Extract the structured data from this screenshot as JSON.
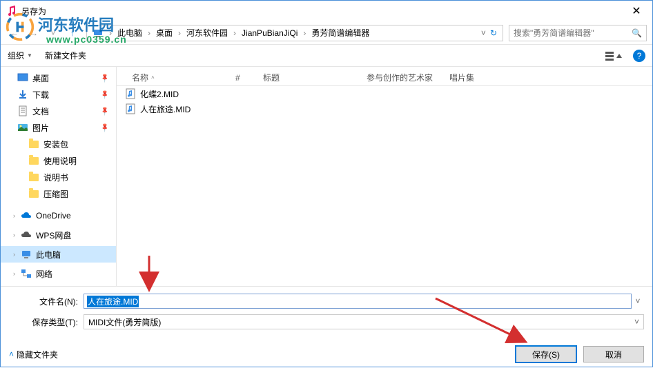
{
  "window": {
    "title": "另存为"
  },
  "nav": {
    "crumbs": [
      "此电脑",
      "桌面",
      "河东软件园",
      "JianPuBianJiQi",
      "勇芳简谱编辑器"
    ],
    "search_placeholder": "搜索\"勇芳简谱编辑器\""
  },
  "toolbar": {
    "organize": "组织",
    "new_folder": "新建文件夹"
  },
  "sidebar": {
    "desktop": "桌面",
    "downloads": "下载",
    "documents": "文档",
    "pictures": "图片",
    "folder1": "安装包",
    "folder2": "使用说明",
    "folder3": "说明书",
    "folder4": "压缩图",
    "onedrive": "OneDrive",
    "wps": "WPS网盘",
    "thispc": "此电脑",
    "network": "网络"
  },
  "columns": {
    "name": "名称",
    "num": "#",
    "title": "标题",
    "artist": "参与创作的艺术家",
    "album": "唱片集"
  },
  "files": [
    {
      "name": "化蝶2.MID"
    },
    {
      "name": "人在旅途.MID"
    }
  ],
  "form": {
    "filename_label": "文件名(N):",
    "filename_value": "人在旅途.MID",
    "filetype_label": "保存类型(T):",
    "filetype_value": "MIDI文件(勇芳简版)"
  },
  "footer": {
    "hide_folders": "隐藏文件夹",
    "save": "保存(S)",
    "cancel": "取消"
  },
  "watermark": {
    "name": "河东软件园",
    "url": "www.pc0359.cn"
  }
}
